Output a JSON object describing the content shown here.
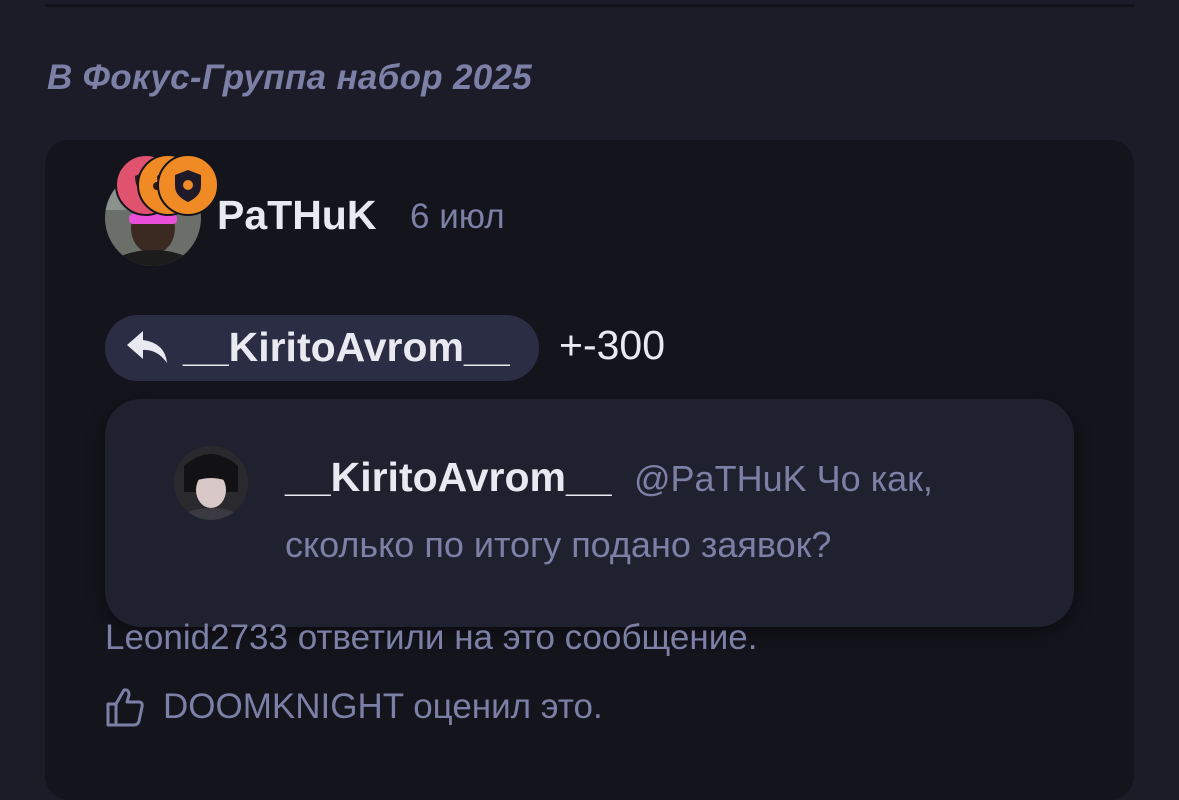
{
  "section": {
    "title": "В Фокус-Группа набор 2025"
  },
  "post": {
    "author": "PaTHuK",
    "time": "6 июл",
    "reply_to": "__KiritoAvrom__",
    "text": "+-300"
  },
  "quote": {
    "author": "__KiritoAvrom__",
    "text_line1": "@PaTHuK Чо как,",
    "text_line2": "сколько по итогу подано заявок?"
  },
  "activity": {
    "replies": "Leonid2733 ответили на это сообщение.",
    "reaction": "DOOMKNIGHT оценил это."
  },
  "colors": {
    "background": "#1c1c28",
    "card": "#14141c",
    "quote_card": "#20212e",
    "chip": "#2b2d44",
    "muted_text": "#7c7fa6",
    "primary_text": "#e9e9f1",
    "badge_red": "#e0526e",
    "badge_orange": "#f08a24"
  },
  "icons": {
    "reply": "reply-arrow-icon",
    "like": "thumbs-up-icon",
    "badges": [
      "mask-icon",
      "paw-icon",
      "shield-icon"
    ]
  }
}
